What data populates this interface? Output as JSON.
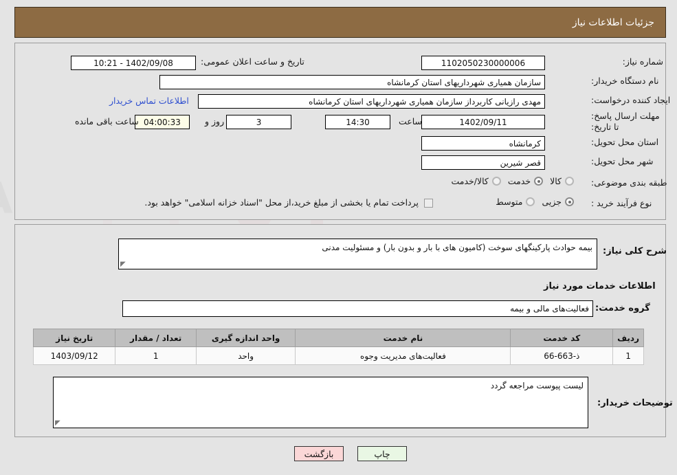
{
  "header": {
    "title": "جزئیات اطلاعات نیاز"
  },
  "form": {
    "labels": {
      "need_number": "شماره نیاز:",
      "buyer_org": "نام دستگاه خریدار:",
      "request_creator": "ایجاد کننده درخواست:",
      "deadline": "مهلت ارسال پاسخ: تا تاریخ:",
      "delivery_province": "استان محل تحویل:",
      "delivery_city": "شهر محل تحویل:",
      "category": "طبقه بندی موضوعی:",
      "purchase_type": "نوع فرآیند خرید :",
      "announce_datetime": "تاریخ و ساعت اعلان عمومی:",
      "hour": "ساعت",
      "day_and": "روز و",
      "hours_remaining": "ساعت باقی مانده"
    },
    "values": {
      "need_number": "1102050230000006",
      "buyer_org": "سازمان همیاری شهرداریهای استان کرمانشاه",
      "request_creator": "مهدی رازیانی کاربرداز سازمان همیاری شهرداریهای استان کرمانشاه",
      "announce_datetime": "1402/09/08 - 10:21",
      "deadline_date": "1402/09/11",
      "deadline_time": "14:30",
      "days_left": "3",
      "time_left": "04:00:33",
      "delivery_province": "کرمانشاه",
      "delivery_city": "قصر شیرین"
    },
    "contact_link": "اطلاعات تماس خریدار",
    "category_options": [
      {
        "label": "کالا",
        "selected": false
      },
      {
        "label": "خدمت",
        "selected": true
      },
      {
        "label": "کالا/خدمت",
        "selected": false
      }
    ],
    "purchase_options": [
      {
        "label": "جزیی",
        "selected": true
      },
      {
        "label": "متوسط",
        "selected": false
      }
    ],
    "treasury_checkbox": {
      "checked": false,
      "label": "پرداخت تمام یا بخشی از مبلغ خرید،از محل \"اسناد خزانه اسلامی\" خواهد بود."
    }
  },
  "description": {
    "label": "شرح کلی نیاز:",
    "value": "بیمه حوادث پارکینگهای سوخت (کامیون های با بار و بدون بار) و مسئولیت مدنی"
  },
  "services_section": {
    "title": "اطلاعات خدمات مورد نیاز",
    "group_label": "گروه خدمت:",
    "group_value": "فعالیت‌های مالی و بیمه"
  },
  "table": {
    "columns": [
      "ردیف",
      "کد خدمت",
      "نام خدمت",
      "واحد اندازه گیری",
      "تعداد / مقدار",
      "تاریخ نیاز"
    ],
    "rows": [
      {
        "row_no": "1",
        "service_code": "ذ-663-66",
        "service_name": "فعالیت‌های مدیریت وجوه",
        "unit": "واحد",
        "quantity": "1",
        "need_date": "1403/09/12"
      }
    ]
  },
  "buyer_notes": {
    "label": "توضیحات خریدار:",
    "value": "لیست پیوست مراجعه گردد"
  },
  "footer": {
    "print_label": "چاپ",
    "back_label": "بازگشت"
  },
  "watermark": {
    "text": "AriaTender.net"
  },
  "colors": {
    "header_bg": "#8d6b43",
    "page_bg": "#e4e4e4",
    "link": "#2f4fcf",
    "print_btn": "#e9f7e4",
    "back_btn": "#fbd7d7",
    "timer_field": "#fdfde8"
  }
}
